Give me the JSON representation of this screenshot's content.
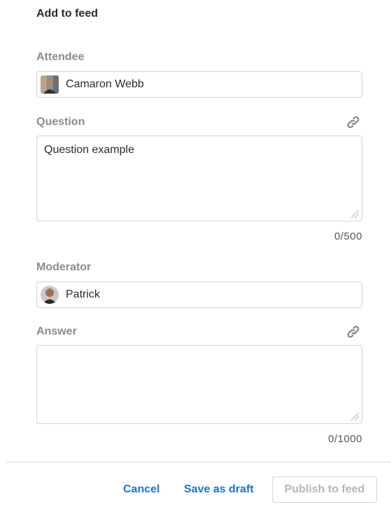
{
  "dialog": {
    "title": "Add to feed"
  },
  "attendee": {
    "label": "Attendee",
    "value": "Camaron Webb"
  },
  "question": {
    "label": "Question",
    "value": "Question example",
    "counter": "0/500"
  },
  "moderator": {
    "label": "Moderator",
    "value": "Patrick"
  },
  "answer": {
    "label": "Answer",
    "value": "",
    "counter": "0/1000"
  },
  "footer": {
    "cancel_label": "Cancel",
    "save_draft_label": "Save as draft",
    "publish_label": "Publish to feed"
  },
  "colors": {
    "accent": "#1a73d9",
    "label": "#8c8c8c",
    "border": "#d3d3d3",
    "disabled_text": "#b5b5b5"
  },
  "icons": {
    "link": "link-icon",
    "resize": "resize-handle-icon"
  }
}
